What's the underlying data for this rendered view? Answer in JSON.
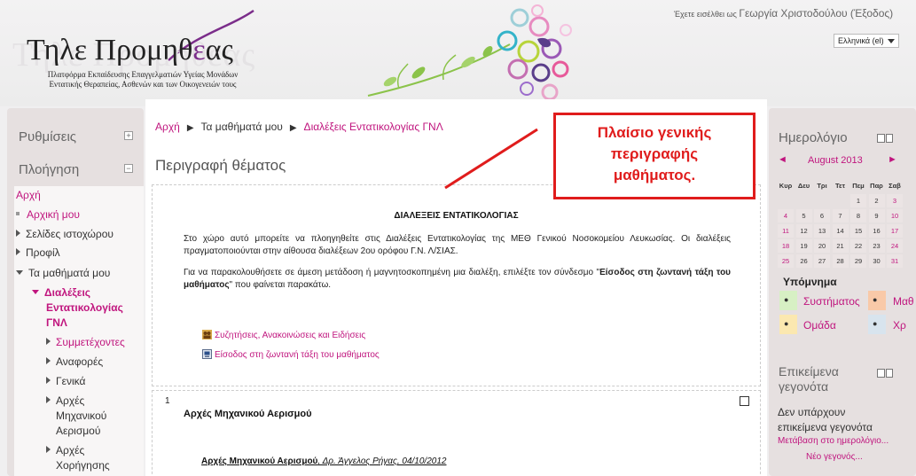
{
  "header": {
    "logo_title_pre": "Τηλε Προμηθ",
    "logo_title_accent": "ε",
    "logo_title_post": "ας",
    "logo_sub_1": "Πλατφόρμα Εκπαίδευσης Επαγγελματιών Υγείας Μονάδων",
    "logo_sub_2": "Εντατικής Θεραπείας, Ασθενών και των Οικογενειών τους",
    "login_prefix": "Έχετε εισέλθει ως",
    "login_name": "Γεωργία Χριστοδούλου (Έξοδος)",
    "language": "Ελληνικά (el)"
  },
  "left": {
    "settings_title": "Ρυθμίσεις",
    "nav_title": "Πλοήγηση",
    "nav": {
      "home": "Αρχή",
      "my_home": "Αρχική μου",
      "site_pages": "Σελίδες ιστοχώρου",
      "profile": "Προφίλ",
      "my_courses": "Τα μαθήματά μου",
      "course_1": "Διαλέξεις",
      "course_2": "Εντατικολογίας",
      "course_3": "ΓΝΛ",
      "participants": "Συμμετέχοντες",
      "reports": "Αναφορές",
      "general": "Γενικά",
      "mech_1": "Αρχές",
      "mech_2": "Μηχανικού",
      "mech_3": "Αερισμού",
      "admin_1": "Αρχές",
      "admin_2": "Χορήγησης"
    }
  },
  "main": {
    "breadcrumb": {
      "home": "Αρχή",
      "my_courses": "Τα μαθήματά μου",
      "course": "Διαλέξεις Εντατικολογίας ΓΝΛ"
    },
    "title": "Περιγραφή θέματος",
    "summary": {
      "heading": "ΔΙΑΛΕΞΕΙΣ ΕΝΤΑΤΙΚΟΛΟΓΙΑΣ",
      "p1": "Στο χώρο αυτό μπορείτε να πλοηγηθείτε στις Διαλέξεις Εντατικολογίας της ΜΕΘ Γενικού Νοσοκομείου Λευκωσίας. Οι διαλέξεις πραγματοποιούνται στην αίθουσα διαλέξεων 2ου ορόφου Γ.Ν. Λ/ΣΙΑΣ.",
      "p2_pre": "Για να παρακολουθήσετε σε άμεση μετάδοση ή μαγνητοσκοπημένη μια διαλέξη, επιλέξτε τον σύνδεσμο \"",
      "p2_bold": "Είσοδος στη ζωντανή τάξη του μαθήματος",
      "p2_post": "\" που φαίνεται παρακάτω.",
      "activity_forum": "Συζητήσεις, Ανακοινώσεις και Ειδήσεις",
      "activity_live": "Είσοδος στη ζωντανή τάξη του μαθήματος"
    },
    "section1": {
      "number": "1",
      "title": "Αρχές Μηχανικού Αερισμού",
      "line_bold": "Αρχές Μηχανικού Αερισμού",
      "line_rest": ", Δρ. Άγγελος Ρήγας, 04/10/2012"
    }
  },
  "callout": {
    "line1": "Πλαίσιο γενικής",
    "line2": "περιγραφής",
    "line3": "μαθήματος."
  },
  "right": {
    "calendar_title": "Ημερολόγιο",
    "month": "August 2013",
    "weekdays": [
      "Κυρ",
      "Δευ",
      "Τρι",
      "Τετ",
      "Πεμ",
      "Παρ",
      "Σαβ"
    ],
    "legend_title": "Υπόμνημα",
    "legend_system": "Συστήματος",
    "legend_course": "Μαθ",
    "legend_group": "Ομάδα",
    "legend_user": "Χρ",
    "events_title_1": "Επικείμενα",
    "events_title_2": "γεγονότα",
    "events_none_1": "Δεν υπάρχουν",
    "events_none_2": "επικείμενα γεγονότα",
    "events_goto": "Μετάβαση στο ημερολόγιο...",
    "events_new": "Νέο γεγονός..."
  },
  "colors": {
    "accent_pink": "#c0157e",
    "callout_red": "#e01c1c",
    "logo_purple": "#7b2d8a"
  }
}
